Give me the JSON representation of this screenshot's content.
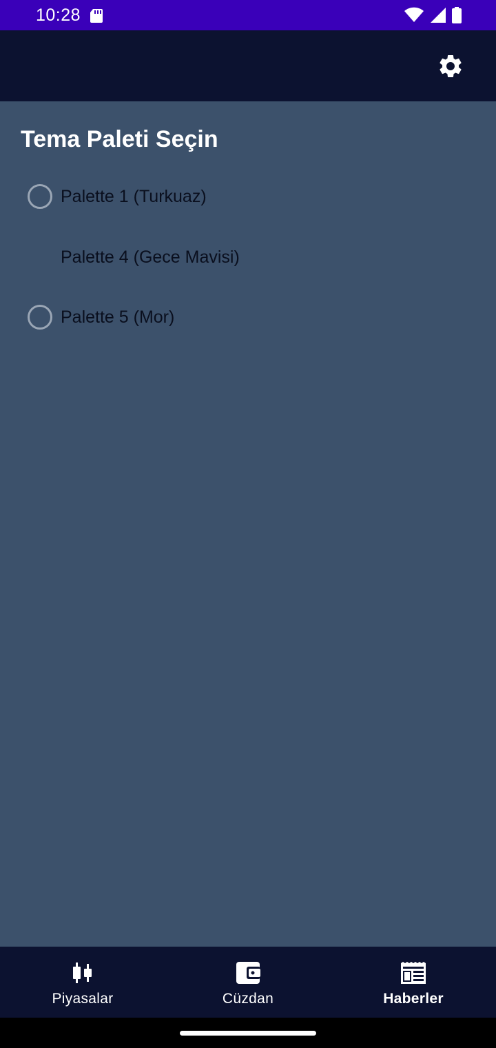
{
  "status_bar": {
    "time": "10:28",
    "icons": [
      "sd-card-icon",
      "wifi-icon",
      "signal-icon",
      "battery-icon"
    ]
  },
  "app_bar": {
    "settings_icon": "gear-icon"
  },
  "main": {
    "title": "Tema Paleti Seçin",
    "options": [
      {
        "label": "Palette 1 (Turkuaz)",
        "radio_visible": true,
        "selected": false
      },
      {
        "label": "Palette 4 (Gece Mavisi)",
        "radio_visible": false,
        "selected": false
      },
      {
        "label": "Palette 5 (Mor)",
        "radio_visible": true,
        "selected": false
      }
    ]
  },
  "bottom_nav": {
    "items": [
      {
        "label": "Piyasalar",
        "icon": "candlestick-chart-icon",
        "active": false
      },
      {
        "label": "Cüzdan",
        "icon": "wallet-icon",
        "active": false
      },
      {
        "label": "Haberler",
        "icon": "newspaper-icon",
        "active": true
      }
    ]
  },
  "colors": {
    "status_bar": "#3a00b9",
    "app_bar": "#0c1230",
    "content_bg": "#3c516b",
    "option_text": "#0a0f1e",
    "radio_ring": "#9aa6b5"
  }
}
